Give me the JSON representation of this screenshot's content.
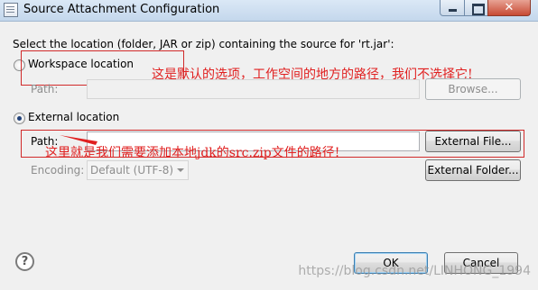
{
  "window": {
    "title": "Source Attachment Configuration"
  },
  "dialog": {
    "instruction": "Select the location (folder, JAR or zip) containing the source for 'rt.jar':",
    "workspace": {
      "label": "Workspace location",
      "selected": false,
      "path_label": "Path:",
      "path_value": "",
      "browse_button": "Browse..."
    },
    "external": {
      "label": "External location",
      "selected": true,
      "path_label": "Path:",
      "path_value": "",
      "external_file_button": "External File...",
      "encoding_label": "Encoding:",
      "encoding_value": "Default (UTF-8)",
      "external_folder_button": "External Folder..."
    },
    "ok_button": "OK",
    "cancel_button": "Cancel",
    "help_glyph": "?"
  },
  "annotations": {
    "workspace_note": "这是默认的选项，工作空间的地方的路径，我们不选择它!",
    "external_note": "这里就是我们需要添加本地jdk的src.zip文件的路径!"
  },
  "watermark": "https://blog.csdn.net/LINHONG_1994",
  "colors": {
    "annotation_red": "#e02020",
    "radio_dot": "#23437a"
  }
}
